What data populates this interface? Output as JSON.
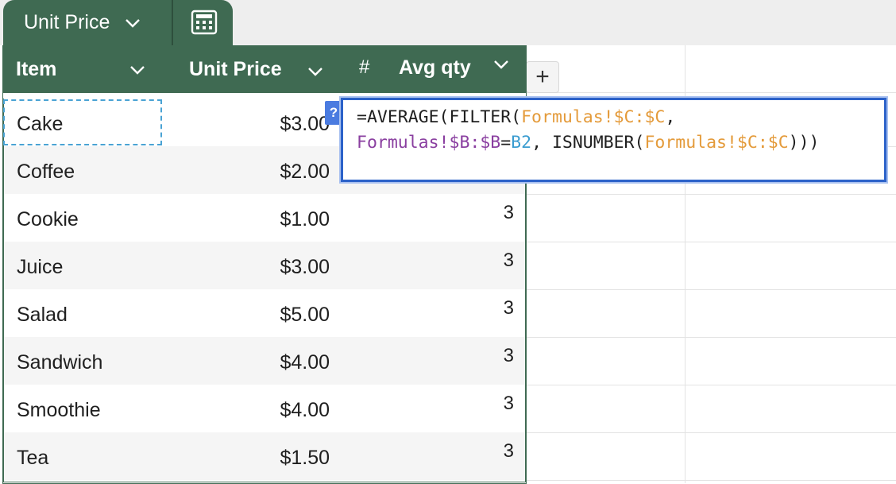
{
  "tab": {
    "name": "Unit Price",
    "calc_icon": "calculator-icon"
  },
  "columns": [
    {
      "label": "Item",
      "type_icon": "chevron-down-icon"
    },
    {
      "label": "Unit Price",
      "type_icon": "chevron-down-icon"
    },
    {
      "label": "Avg qty",
      "type_icon": "hash-icon",
      "type_symbol": "#"
    }
  ],
  "add_column_label": "+",
  "rows": [
    {
      "item": "Cake",
      "price": "$3.00",
      "avg": ""
    },
    {
      "item": "Coffee",
      "price": "$2.00",
      "avg": ""
    },
    {
      "item": "Cookie",
      "price": "$1.00",
      "avg": "3"
    },
    {
      "item": "Juice",
      "price": "$3.00",
      "avg": "3"
    },
    {
      "item": "Salad",
      "price": "$5.00",
      "avg": "3"
    },
    {
      "item": "Sandwich",
      "price": "$4.00",
      "avg": "3"
    },
    {
      "item": "Smoothie",
      "price": "$4.00",
      "avg": "3"
    },
    {
      "item": "Tea",
      "price": "$1.50",
      "avg": "3"
    }
  ],
  "formula": {
    "help_badge": "?",
    "line1": {
      "p1": "=AVERAGE(FILTER(",
      "p2": "Formulas!$C:$C",
      "p3": ","
    },
    "line2": {
      "p1": "Formulas!$B:$B",
      "p2": "=",
      "p3": "B2",
      "p4": ", ISNUMBER(",
      "p5": "Formulas!$C:$C",
      "p6": ")))"
    }
  },
  "colors": {
    "header_bg": "#3f6a52",
    "range_color": "#e49b3b",
    "ref_color": "#8a3fa0",
    "cell_ref_color": "#3a9cd0",
    "editor_border": "#2c62c9"
  }
}
